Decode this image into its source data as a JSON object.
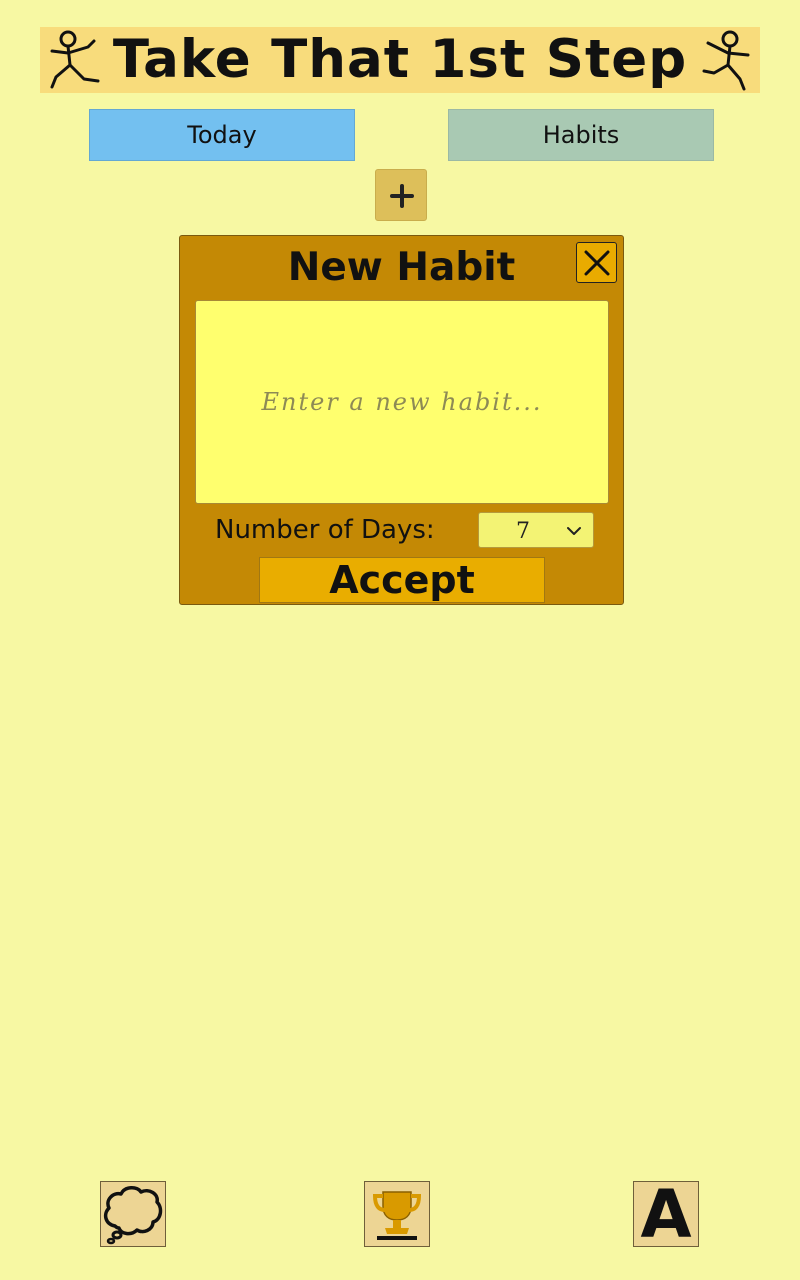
{
  "app": {
    "title": "Take That 1st Step"
  },
  "tabs": [
    {
      "label": "Today",
      "active": true
    },
    {
      "label": "Habits",
      "active": false
    }
  ],
  "add_button": {
    "icon": "plus-icon",
    "label": "+"
  },
  "dialog": {
    "title": "New Habit",
    "close_icon": "close-icon",
    "habit_input": {
      "value": "",
      "placeholder": "Enter a new habit..."
    },
    "days_label": "Number of Days:",
    "days_select": {
      "selected": "7"
    },
    "accept_label": "Accept"
  },
  "bottom_bar": {
    "icons": [
      "thought-bubble-icon",
      "trophy-icon",
      "font-icon"
    ],
    "font_glyph": "A"
  },
  "colors": {
    "background": "#f7f8a3",
    "header": "#f8dc7c",
    "today_tab": "#73c0f0",
    "habits_tab": "#a9c9b3",
    "dialog": "#c48905",
    "input": "#ffff6e",
    "accept": "#e9ad00"
  }
}
